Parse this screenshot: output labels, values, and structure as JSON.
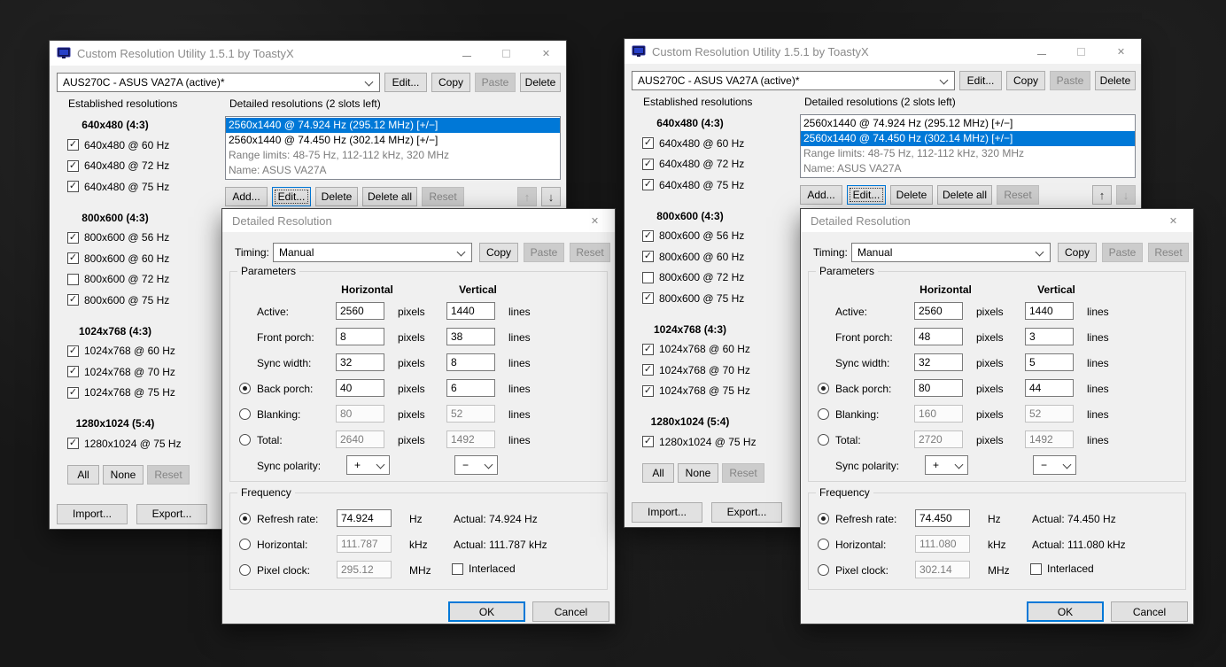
{
  "background_color": "#171717",
  "accent_color": "#0078d7",
  "windows": [
    {
      "title": "Custom Resolution Utility 1.5.1 by ToastyX",
      "monitor_select": "AUS270C - ASUS VA27A (active)*",
      "toolbar": {
        "edit": "Edit...",
        "copy": "Copy",
        "paste": "Paste",
        "delete": "Delete"
      },
      "established": {
        "label": "Established resolutions",
        "groups": [
          {
            "header": "640x480 (4:3)",
            "items": [
              {
                "label": "640x480 @ 60 Hz",
                "checked": true
              },
              {
                "label": "640x480 @ 72 Hz",
                "checked": true
              },
              {
                "label": "640x480 @ 75 Hz",
                "checked": true
              }
            ]
          },
          {
            "header": "800x600 (4:3)",
            "items": [
              {
                "label": "800x600 @ 56 Hz",
                "checked": true
              },
              {
                "label": "800x600 @ 60 Hz",
                "checked": true
              },
              {
                "label": "800x600 @ 72 Hz",
                "checked": false
              },
              {
                "label": "800x600 @ 75 Hz",
                "checked": true
              }
            ]
          },
          {
            "header": "1024x768 (4:3)",
            "items": [
              {
                "label": "1024x768 @ 60 Hz",
                "checked": true
              },
              {
                "label": "1024x768 @ 70 Hz",
                "checked": true
              },
              {
                "label": "1024x768 @ 75 Hz",
                "checked": true
              }
            ]
          },
          {
            "header": "1280x1024 (5:4)",
            "items": [
              {
                "label": "1280x1024 @ 75 Hz",
                "checked": true
              }
            ]
          }
        ],
        "buttons": {
          "all": "All",
          "none": "None",
          "reset": "Reset"
        }
      },
      "detailed": {
        "label": "Detailed resolutions (2 slots left)",
        "items": [
          {
            "text": "2560x1440 @ 74.924 Hz (295.12 MHz) [+/−]",
            "selected": true,
            "muted": false
          },
          {
            "text": "2560x1440 @ 74.450 Hz (302.14 MHz) [+/−]",
            "selected": false,
            "muted": false
          },
          {
            "text": "Range limits: 48-75 Hz, 112-112 kHz, 320 MHz",
            "selected": false,
            "muted": true
          },
          {
            "text": "Name: ASUS VA27A",
            "selected": false,
            "muted": true
          }
        ],
        "buttons": {
          "add": "Add...",
          "edit": "Edit...",
          "delete": "Delete",
          "delete_all": "Delete all",
          "reset": "Reset"
        },
        "move_up_enabled": false,
        "move_down_enabled": true
      },
      "footer": {
        "import": "Import...",
        "export": "Export..."
      },
      "dialog": {
        "title": "Detailed Resolution",
        "timing": {
          "label": "Timing:",
          "value": "Manual",
          "copy": "Copy",
          "paste": "Paste",
          "reset": "Reset"
        },
        "parameters": {
          "label": "Parameters",
          "columns": {
            "horizontal": "Horizontal",
            "vertical": "Vertical"
          },
          "rows": [
            {
              "label": "Active:",
              "control": "none",
              "selected": false,
              "h_value": "2560",
              "h_unit": "pixels",
              "h_disabled": false,
              "v_value": "1440",
              "v_unit": "lines",
              "v_disabled": false
            },
            {
              "label": "Front porch:",
              "control": "none",
              "selected": false,
              "h_value": "8",
              "h_unit": "pixels",
              "h_disabled": false,
              "v_value": "38",
              "v_unit": "lines",
              "v_disabled": false
            },
            {
              "label": "Sync width:",
              "control": "none",
              "selected": false,
              "h_value": "32",
              "h_unit": "pixels",
              "h_disabled": false,
              "v_value": "8",
              "v_unit": "lines",
              "v_disabled": false
            },
            {
              "label": "Back porch:",
              "control": "radio",
              "selected": true,
              "h_value": "40",
              "h_unit": "pixels",
              "h_disabled": false,
              "v_value": "6",
              "v_unit": "lines",
              "v_disabled": false
            },
            {
              "label": "Blanking:",
              "control": "radio",
              "selected": false,
              "h_value": "80",
              "h_unit": "pixels",
              "h_disabled": true,
              "v_value": "52",
              "v_unit": "lines",
              "v_disabled": true
            },
            {
              "label": "Total:",
              "control": "radio",
              "selected": false,
              "h_value": "2640",
              "h_unit": "pixels",
              "h_disabled": true,
              "v_value": "1492",
              "v_unit": "lines",
              "v_disabled": true
            }
          ],
          "sync_polarity": {
            "label": "Sync polarity:",
            "h_value": "+",
            "v_value": "−"
          }
        },
        "frequency": {
          "label": "Frequency",
          "rows": [
            {
              "label": "Refresh rate:",
              "selected": true,
              "value": "74.924",
              "unit": "Hz",
              "disabled": false,
              "actual": "Actual: 74.924 Hz"
            },
            {
              "label": "Horizontal:",
              "selected": false,
              "value": "111.787",
              "unit": "kHz",
              "disabled": true,
              "actual": "Actual: 111.787 kHz"
            },
            {
              "label": "Pixel clock:",
              "selected": false,
              "value": "295.12",
              "unit": "MHz",
              "disabled": true,
              "interlaced_label": "Interlaced",
              "interlaced_checked": false
            }
          ]
        },
        "ok": "OK",
        "cancel": "Cancel"
      }
    },
    {
      "title": "Custom Resolution Utility 1.5.1 by ToastyX",
      "monitor_select": "AUS270C - ASUS VA27A (active)*",
      "toolbar": {
        "edit": "Edit...",
        "copy": "Copy",
        "paste": "Paste",
        "delete": "Delete"
      },
      "established": {
        "label": "Established resolutions",
        "groups": [
          {
            "header": "640x480 (4:3)",
            "items": [
              {
                "label": "640x480 @ 60 Hz",
                "checked": true
              },
              {
                "label": "640x480 @ 72 Hz",
                "checked": true
              },
              {
                "label": "640x480 @ 75 Hz",
                "checked": true
              }
            ]
          },
          {
            "header": "800x600 (4:3)",
            "items": [
              {
                "label": "800x600 @ 56 Hz",
                "checked": true
              },
              {
                "label": "800x600 @ 60 Hz",
                "checked": true
              },
              {
                "label": "800x600 @ 72 Hz",
                "checked": false
              },
              {
                "label": "800x600 @ 75 Hz",
                "checked": true
              }
            ]
          },
          {
            "header": "1024x768 (4:3)",
            "items": [
              {
                "label": "1024x768 @ 60 Hz",
                "checked": true
              },
              {
                "label": "1024x768 @ 70 Hz",
                "checked": true
              },
              {
                "label": "1024x768 @ 75 Hz",
                "checked": true
              }
            ]
          },
          {
            "header": "1280x1024 (5:4)",
            "items": [
              {
                "label": "1280x1024 @ 75 Hz",
                "checked": true
              }
            ]
          }
        ],
        "buttons": {
          "all": "All",
          "none": "None",
          "reset": "Reset"
        }
      },
      "detailed": {
        "label": "Detailed resolutions (2 slots left)",
        "items": [
          {
            "text": "2560x1440 @ 74.924 Hz (295.12 MHz) [+/−]",
            "selected": false,
            "muted": false
          },
          {
            "text": "2560x1440 @ 74.450 Hz (302.14 MHz) [+/−]",
            "selected": true,
            "muted": false
          },
          {
            "text": "Range limits: 48-75 Hz, 112-112 kHz, 320 MHz",
            "selected": false,
            "muted": true
          },
          {
            "text": "Name: ASUS VA27A",
            "selected": false,
            "muted": true
          }
        ],
        "buttons": {
          "add": "Add...",
          "edit": "Edit...",
          "delete": "Delete",
          "delete_all": "Delete all",
          "reset": "Reset"
        },
        "move_up_enabled": true,
        "move_down_enabled": false
      },
      "footer": {
        "import": "Import...",
        "export": "Export..."
      },
      "dialog": {
        "title": "Detailed Resolution",
        "timing": {
          "label": "Timing:",
          "value": "Manual",
          "copy": "Copy",
          "paste": "Paste",
          "reset": "Reset"
        },
        "parameters": {
          "label": "Parameters",
          "columns": {
            "horizontal": "Horizontal",
            "vertical": "Vertical"
          },
          "rows": [
            {
              "label": "Active:",
              "control": "none",
              "selected": false,
              "h_value": "2560",
              "h_unit": "pixels",
              "h_disabled": false,
              "v_value": "1440",
              "v_unit": "lines",
              "v_disabled": false
            },
            {
              "label": "Front porch:",
              "control": "none",
              "selected": false,
              "h_value": "48",
              "h_unit": "pixels",
              "h_disabled": false,
              "v_value": "3",
              "v_unit": "lines",
              "v_disabled": false
            },
            {
              "label": "Sync width:",
              "control": "none",
              "selected": false,
              "h_value": "32",
              "h_unit": "pixels",
              "h_disabled": false,
              "v_value": "5",
              "v_unit": "lines",
              "v_disabled": false
            },
            {
              "label": "Back porch:",
              "control": "radio",
              "selected": true,
              "h_value": "80",
              "h_unit": "pixels",
              "h_disabled": false,
              "v_value": "44",
              "v_unit": "lines",
              "v_disabled": false
            },
            {
              "label": "Blanking:",
              "control": "radio",
              "selected": false,
              "h_value": "160",
              "h_unit": "pixels",
              "h_disabled": true,
              "v_value": "52",
              "v_unit": "lines",
              "v_disabled": true
            },
            {
              "label": "Total:",
              "control": "radio",
              "selected": false,
              "h_value": "2720",
              "h_unit": "pixels",
              "h_disabled": true,
              "v_value": "1492",
              "v_unit": "lines",
              "v_disabled": true
            }
          ],
          "sync_polarity": {
            "label": "Sync polarity:",
            "h_value": "+",
            "v_value": "−"
          }
        },
        "frequency": {
          "label": "Frequency",
          "rows": [
            {
              "label": "Refresh rate:",
              "selected": true,
              "value": "74.450",
              "unit": "Hz",
              "disabled": false,
              "actual": "Actual: 74.450 Hz"
            },
            {
              "label": "Horizontal:",
              "selected": false,
              "value": "111.080",
              "unit": "kHz",
              "disabled": true,
              "actual": "Actual: 111.080 kHz"
            },
            {
              "label": "Pixel clock:",
              "selected": false,
              "value": "302.14",
              "unit": "MHz",
              "disabled": true,
              "interlaced_label": "Interlaced",
              "interlaced_checked": false
            }
          ]
        },
        "ok": "OK",
        "cancel": "Cancel"
      }
    }
  ]
}
